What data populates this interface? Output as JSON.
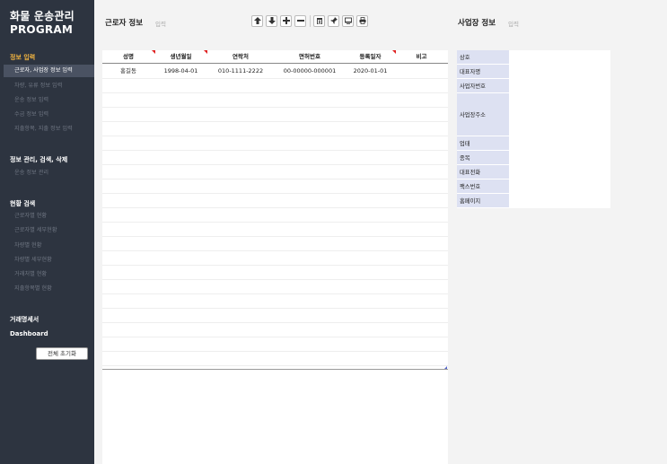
{
  "app": {
    "title_line1": "화물 운송관리",
    "title_line2": "PROGRAM"
  },
  "sidebar": {
    "section_input": "정보 입력",
    "input_items": [
      "근로자, 사업장 정보 입력",
      "차량, 유류 정보 입력",
      "운송 정보 입력",
      "수금 정보 입력",
      "지출항목, 지출 정보 입력"
    ],
    "section_manage": "정보 관리, 검색, 삭제",
    "manage_items": [
      "운송 정보 관리"
    ],
    "section_status": "현황 검색",
    "status_items": [
      "근로자별 현황",
      "근로자별 세부현황",
      "차량별 현황",
      "차량별 세부현황",
      "거래처별 현황",
      "지출항목별 현황"
    ],
    "section_invoice": "거래명세서",
    "section_dashboard": "Dashboard",
    "reset_label": "전체 초기화"
  },
  "worker": {
    "title": "근로자 정보",
    "subtitle": "입력",
    "columns": [
      "성명",
      "생년월일",
      "연락처",
      "면허번호",
      "등록일자",
      "비고"
    ],
    "rows": [
      [
        "홍길동",
        "1998-04-01",
        "010-1111-2222",
        "00-00000-000001",
        "2020-01-01",
        ""
      ]
    ]
  },
  "toolbar": {
    "buttons": [
      "move-up",
      "move-down",
      "add-row",
      "remove-row",
      "delete",
      "pin",
      "monitor",
      "print"
    ]
  },
  "business": {
    "title": "사업장 정보",
    "subtitle": "입력",
    "fields": [
      "상호",
      "대표자명",
      "사업자번호",
      "사업장주소",
      "업태",
      "종목",
      "대표전화",
      "팩스번호",
      "홈페이지"
    ]
  },
  "colors": {
    "sidebar_bg": "#2d3440",
    "accent": "#f0b340",
    "active_item_bg": "#4a5262",
    "label_bg": "#dde1f2",
    "required_marker": "#e02020"
  }
}
